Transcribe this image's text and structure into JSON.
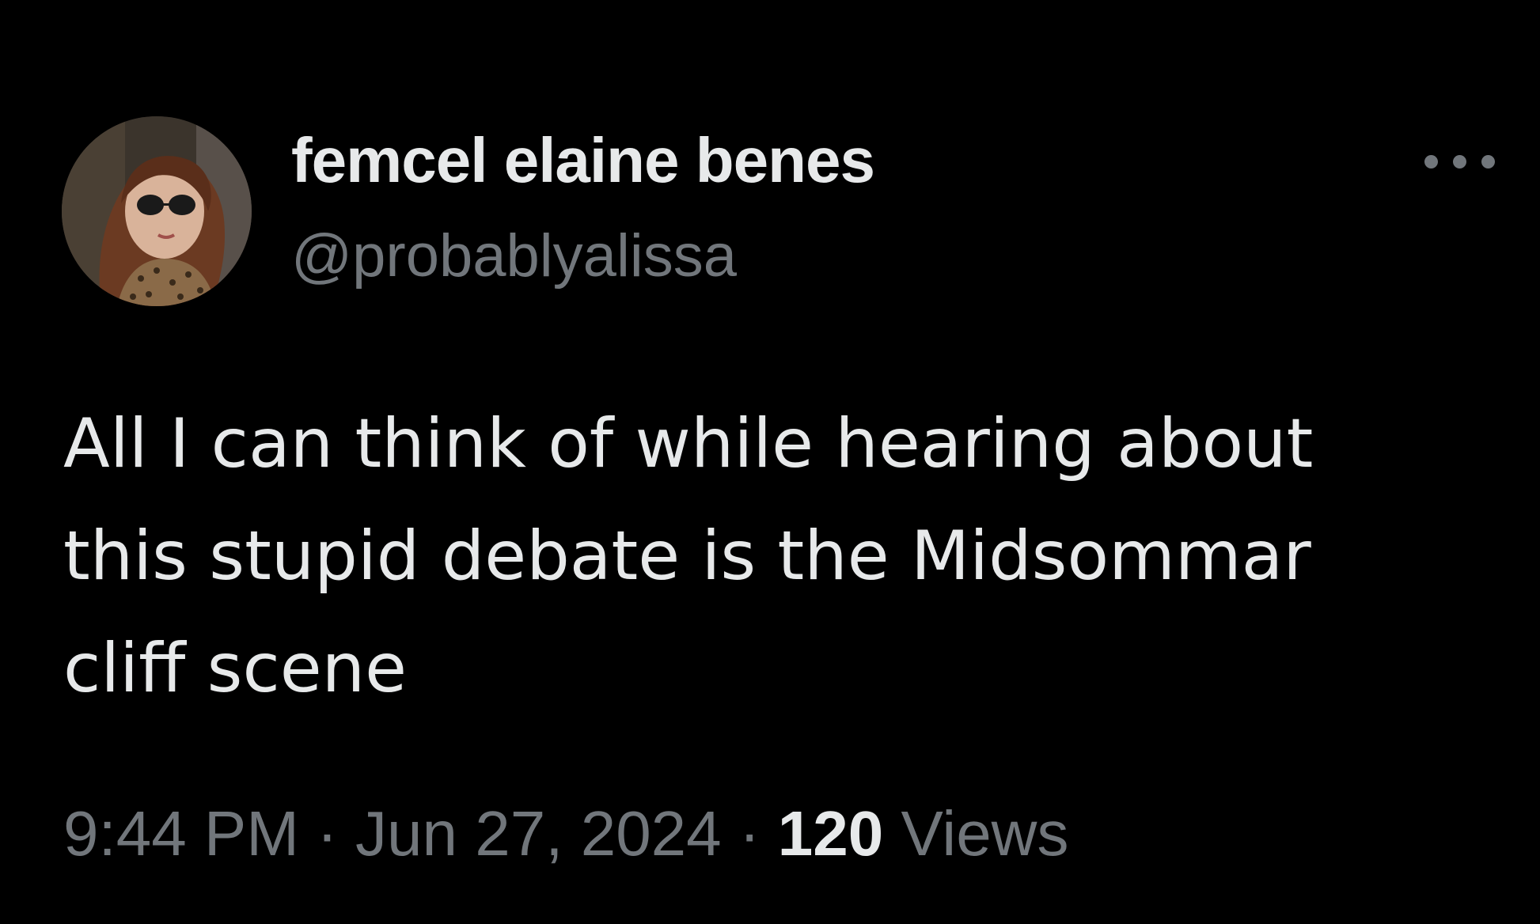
{
  "author": {
    "display_name": "femcel elaine benes",
    "handle": "@probablyalissa"
  },
  "tweet": {
    "text_lines": [
      "All I can think of while hearing about",
      "this stupid debate is the Midsommar",
      "cliff scene"
    ]
  },
  "meta": {
    "time": "9:44 PM",
    "separator": "·",
    "date": "Jun 27, 2024",
    "views_count": "120",
    "views_label": "Views"
  },
  "icons": {
    "more": "more-options-icon"
  },
  "colors": {
    "background": "#000000",
    "primary_text": "#e7e9ea",
    "secondary_text": "#71767b"
  }
}
